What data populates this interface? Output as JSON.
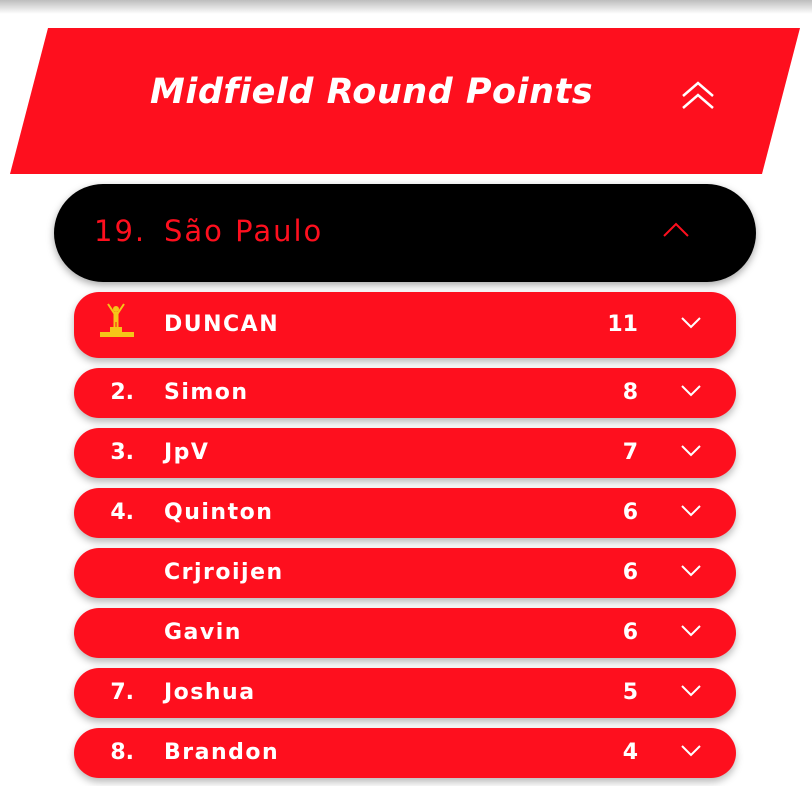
{
  "header": {
    "title": "Midfield Round Points"
  },
  "race": {
    "number": "19.",
    "name": "São Paulo"
  },
  "standings": [
    {
      "position": "",
      "name": "DUNCAN",
      "points": "11",
      "icon": "podium-trophy-icon"
    },
    {
      "position": "2.",
      "name": "Simon",
      "points": "8"
    },
    {
      "position": "3.",
      "name": "JpV",
      "points": "7"
    },
    {
      "position": "4.",
      "name": "Quinton",
      "points": "6"
    },
    {
      "position": "",
      "name": "Crjroijen",
      "points": "6"
    },
    {
      "position": "",
      "name": "Gavin",
      "points": "6"
    },
    {
      "position": "7.",
      "name": "Joshua",
      "points": "5"
    },
    {
      "position": "8.",
      "name": "Brandon",
      "points": "4"
    }
  ],
  "colors": {
    "accent_red": "#fe0f1e",
    "card_black": "#000000",
    "text_white": "#ffffff",
    "trophy_gold": "#f5c518"
  }
}
